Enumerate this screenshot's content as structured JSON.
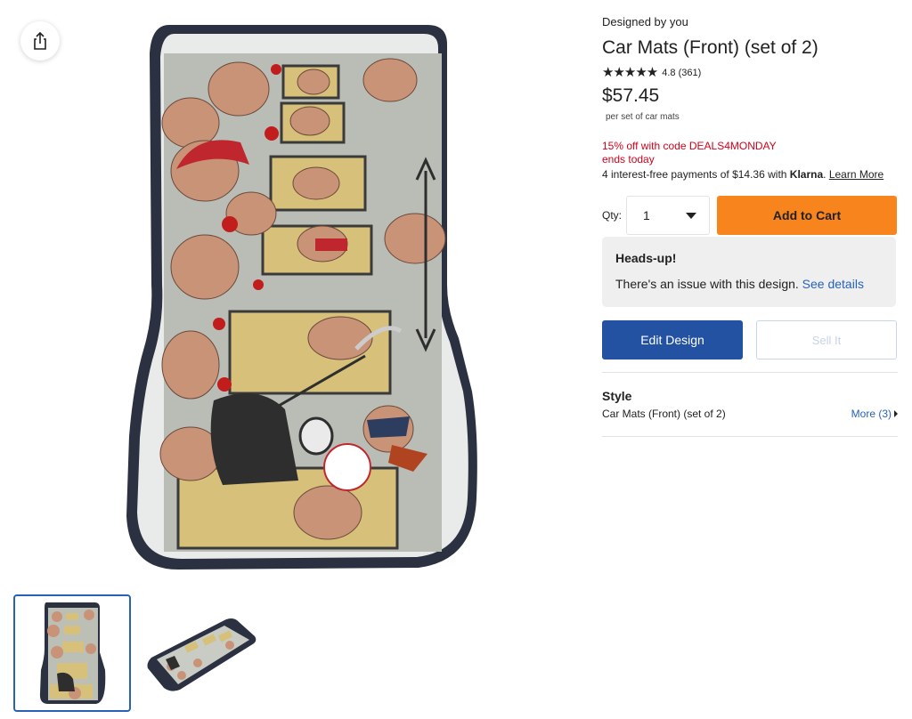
{
  "product": {
    "designed_by": "Designed by you",
    "title": "Car Mats (Front) (set of 2)",
    "stars": "★★★★★",
    "rating": 4.8,
    "rating_text": "4.8 (361)",
    "price": "$57.45",
    "price_unit": "per set of car mats",
    "promo_line1": "15% off with code DEALS4MONDAY",
    "promo_line2": "ends today",
    "klarna_prefix": "4 interest-free payments of $14.36 with ",
    "klarna_logo": "Klarna",
    "klarna_link": "Learn More"
  },
  "purchase": {
    "qty_label": "Qty:",
    "qty_value": "1",
    "add_to_cart": "Add to Cart"
  },
  "headsup": {
    "title": "Heads-up!",
    "text": "There's an issue with this design.",
    "link": "See details"
  },
  "actions": {
    "edit_design": "Edit Design",
    "sell_it": "Sell It"
  },
  "style": {
    "title": "Style",
    "value": "Car Mats (Front) (set of 2)",
    "more": "More (3)"
  },
  "icons": {
    "share": "share-icon",
    "qty_caret": "caret-down-icon",
    "more_chevron": "chevron-right-icon"
  },
  "colors": {
    "add_to_cart": "#f8841d",
    "edit_design": "#2252a1",
    "promo": "#d0021b",
    "link": "#2762b8",
    "thumb_selected": "#2762b8"
  }
}
